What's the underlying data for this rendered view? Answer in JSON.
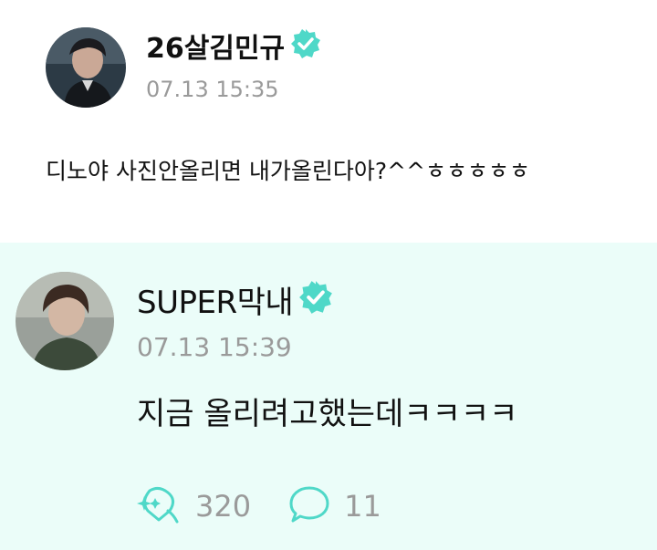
{
  "post": {
    "username": "26살김민규",
    "timestamp": "07.13 15:35",
    "message": "디노야 사진안올리면 내가올린다아?^^ㅎㅎㅎㅎㅎ",
    "avatar": "profile-photo"
  },
  "reply": {
    "username": "SUPER막내",
    "timestamp": "07.13 15:39",
    "message": "지금 올리려고했는데ㅋㅋㅋㅋ",
    "avatar": "profile-photo"
  },
  "stats": {
    "likes": "320",
    "comments": "11",
    "like_icon": "sparkle-heart-icon",
    "comment_icon": "speech-bubble-icon"
  },
  "colors": {
    "accent": "#4fd8c8",
    "reply_background": "#ebfdf9",
    "muted_text": "#9a9a9a"
  }
}
